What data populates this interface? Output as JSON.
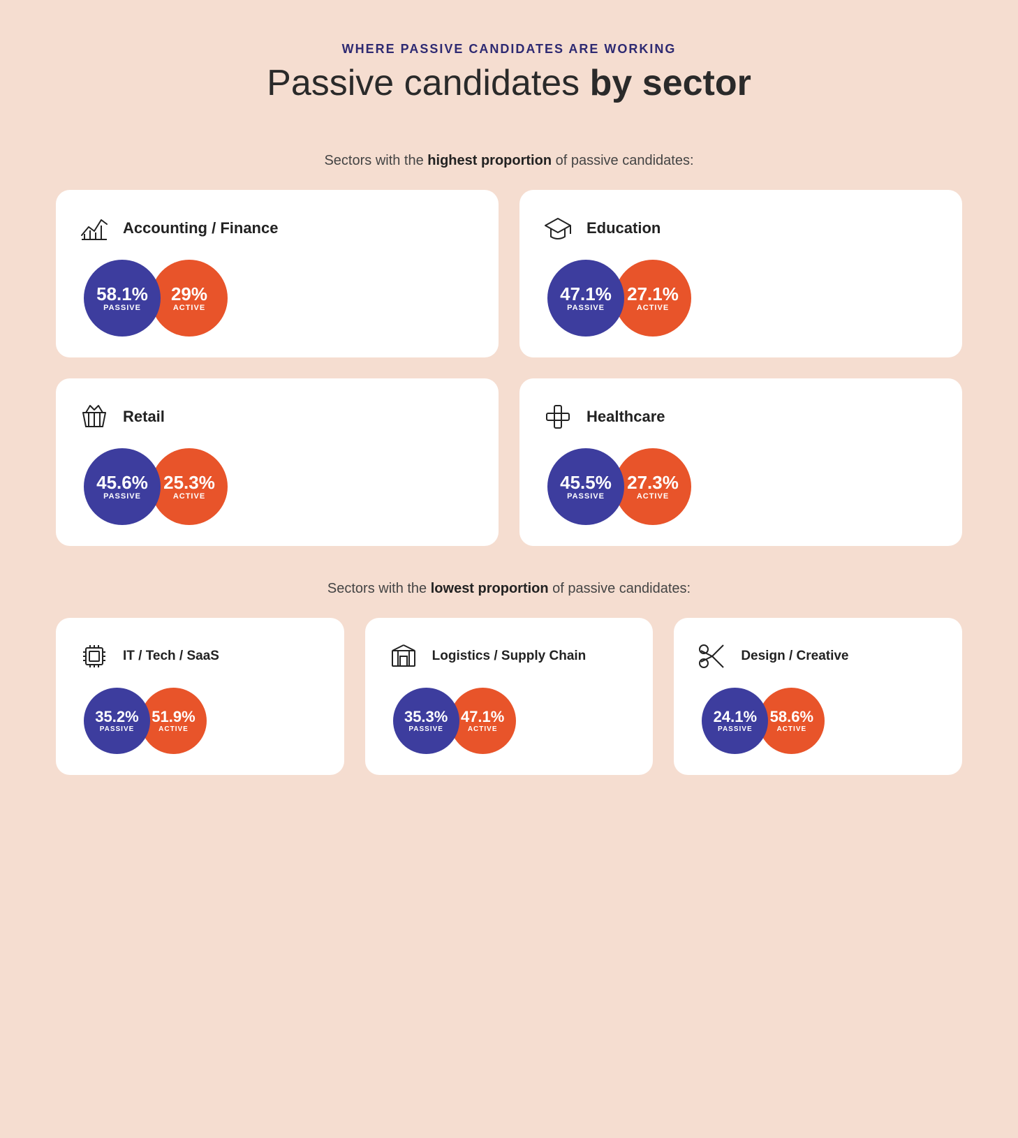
{
  "header": {
    "subtitle": "WHERE PASSIVE CANDIDATES ARE WORKING",
    "title_light": "Passive candidates ",
    "title_bold": "by sector"
  },
  "highest_label": "Sectors with the ",
  "highest_bold": "highest proportion",
  "highest_suffix": " of passive candidates:",
  "lowest_label": "Sectors with the ",
  "lowest_bold": "lowest proportion",
  "lowest_suffix": " of passive candidates:",
  "highest_sectors": [
    {
      "id": "accounting-finance",
      "title": "Accounting / Finance",
      "icon": "finance",
      "passive_pct": "58.1%",
      "passive_label": "PASSIVE",
      "active_pct": "29%",
      "active_label": "ACTIVE"
    },
    {
      "id": "education",
      "title": "Education",
      "icon": "education",
      "passive_pct": "47.1%",
      "passive_label": "PASSIVE",
      "active_pct": "27.1%",
      "active_label": "ACTIVE"
    },
    {
      "id": "retail",
      "title": "Retail",
      "icon": "retail",
      "passive_pct": "45.6%",
      "passive_label": "PASSIVE",
      "active_pct": "25.3%",
      "active_label": "ACTIVE"
    },
    {
      "id": "healthcare",
      "title": "Healthcare",
      "icon": "healthcare",
      "passive_pct": "45.5%",
      "passive_label": "PASSIVE",
      "active_pct": "27.3%",
      "active_label": "ACTIVE"
    }
  ],
  "lowest_sectors": [
    {
      "id": "it-tech",
      "title": "IT / Tech / SaaS",
      "icon": "tech",
      "passive_pct": "35.2%",
      "passive_label": "PASSIVE",
      "active_pct": "51.9%",
      "active_label": "ACTIVE"
    },
    {
      "id": "logistics",
      "title": "Logistics / Supply Chain",
      "icon": "logistics",
      "passive_pct": "35.3%",
      "passive_label": "PASSIVE",
      "active_pct": "47.1%",
      "active_label": "ACTIVE"
    },
    {
      "id": "design-creative",
      "title": "Design / Creative",
      "icon": "design",
      "passive_pct": "24.1%",
      "passive_label": "PASSIVE",
      "active_pct": "58.6%",
      "active_label": "ACTIVE"
    }
  ]
}
